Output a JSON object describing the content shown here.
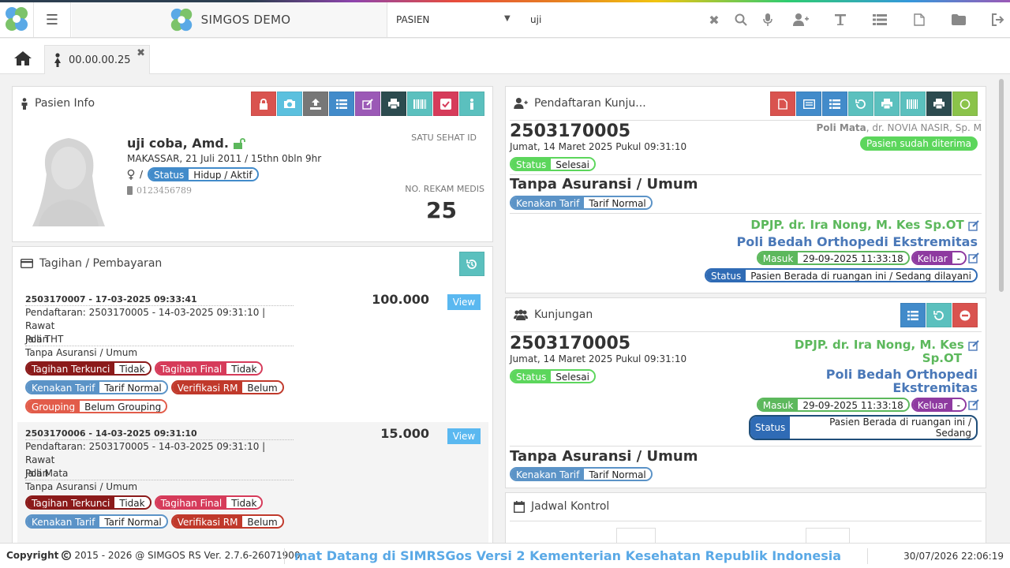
{
  "app": {
    "brand": "SIMGOS DEMO",
    "search_type": "PASIEN",
    "search_query": "uji"
  },
  "tabs": {
    "patient_tab": "00.00.00.25"
  },
  "pasien_info": {
    "title": "Pasien Info",
    "name": "uji coba, Amd.",
    "birth": "MAKASSAR, 21 Juli 2011 / 15thn 0bln 9hr",
    "gender_sep": "/",
    "status_label": "Status",
    "status_value": "Hidup / Aktif",
    "phone": "0123456789",
    "satu_sehat_label": "SATU SEHAT ID",
    "rm_label": "NO. REKAM MEDIS",
    "rm_value": "25"
  },
  "tagihan": {
    "title": "Tagihan / Pembayaran",
    "view_label": "View",
    "bills": [
      {
        "header": "2503170007 - 17-03-2025 09:33:41",
        "pendaftaran_1": "Pendaftaran: 2503170005 - 14-03-2025 09:31:10 | Rawat",
        "pendaftaran_2": "Jalan",
        "poli": "Poli THT",
        "asuransi": "Tanpa Asuransi / Umum",
        "amount": "100.000",
        "terkunci_l": "Tagihan Terkunci",
        "terkunci_r": "Tidak",
        "final_l": "Tagihan Final",
        "final_r": "Tidak",
        "tarif_l": "Kenakan Tarif",
        "tarif_r": "Tarif Normal",
        "verif_l": "Verifikasi RM",
        "verif_r": "Belum",
        "grouping_l": "Grouping",
        "grouping_r": "Belum Grouping"
      },
      {
        "header": "2503170006 - 14-03-2025 09:31:10",
        "pendaftaran_1": "Pendaftaran: 2503170005 - 14-03-2025 09:31:10 | Rawat",
        "pendaftaran_2": "Jalan",
        "poli": "Poli Mata",
        "asuransi": "Tanpa Asuransi / Umum",
        "amount": "15.000",
        "terkunci_l": "Tagihan Terkunci",
        "terkunci_r": "Tidak",
        "final_l": "Tagihan Final",
        "final_r": "Tidak",
        "tarif_l": "Kenakan Tarif",
        "tarif_r": "Tarif Normal",
        "verif_l": "Verifikasi RM",
        "verif_r": "Belum"
      }
    ]
  },
  "pendaftaran": {
    "title": "Pendaftaran Kunju...",
    "number": "2503170005",
    "date": "Jumat, 14 Maret 2025 Pukul 09:31:10",
    "poli_bold": "Poli Mata",
    "doctor": ", dr. NOVIA NASIR, Sp. M",
    "diterima": "Pasien sudah diterima",
    "status_label": "Status",
    "status_value": "Selesai",
    "asuransi": "Tanpa Asuransi / Umum",
    "tarif_label": "Kenakan Tarif",
    "tarif_value": "Tarif Normal",
    "dpjp": "DPJP. dr. Ira Nong, M. Kes Sp.OT",
    "poli_bedah": "Poli Bedah Orthopedi Ekstremitas",
    "masuk_label": "Masuk",
    "masuk_value": "29-09-2025 11:33:18",
    "keluar_label": "Keluar",
    "keluar_value": "-",
    "ruang_label": "Status",
    "ruang_value": "Pasien Berada di ruangan ini / Sedang dilayani"
  },
  "kunjungan": {
    "title": "Kunjungan",
    "number": "2503170005",
    "date": "Jumat, 14 Maret 2025 Pukul 09:31:10",
    "status_label": "Status",
    "status_value": "Selesai",
    "dpjp_1": "DPJP. dr. Ira Nong, M. Kes",
    "dpjp_2": "Sp.OT",
    "poli_1": "Poli Bedah Orthopedi",
    "poli_2": "Ekstremitas",
    "masuk_label": "Masuk",
    "masuk_value": "29-09-2025 11:33:18",
    "keluar_label": "Keluar",
    "keluar_value": "-",
    "ruang_label": "Status",
    "ruang_value_1": "Pasien Berada di ruangan ini / Sedang",
    "ruang_value_2": "dilayani",
    "asuransi": "Tanpa Asuransi / Umum",
    "tarif_label": "Kenakan Tarif",
    "tarif_value": "Tarif Normal"
  },
  "jadwal": {
    "title": "Jadwal Kontrol"
  },
  "footer": {
    "copyright_label": "Copyright",
    "copyright_text": "2015 - 2026 @ SIMGOS RS Ver. 2.7.6-26071900",
    "marquee": "mat Datang di SIMRSGos Versi 2 Kementerian Kesehatan Republik Indonesia",
    "clock": "30/07/2026 22:06:19"
  },
  "colors": {
    "red": "#d9534f",
    "blue": "#428bca",
    "teal": "#5bc0be",
    "green": "#5cb85c",
    "maroon": "#8b1a1a",
    "crimson": "#d63b5a",
    "steel": "#5b93c7",
    "purple": "#8e3aa0"
  }
}
